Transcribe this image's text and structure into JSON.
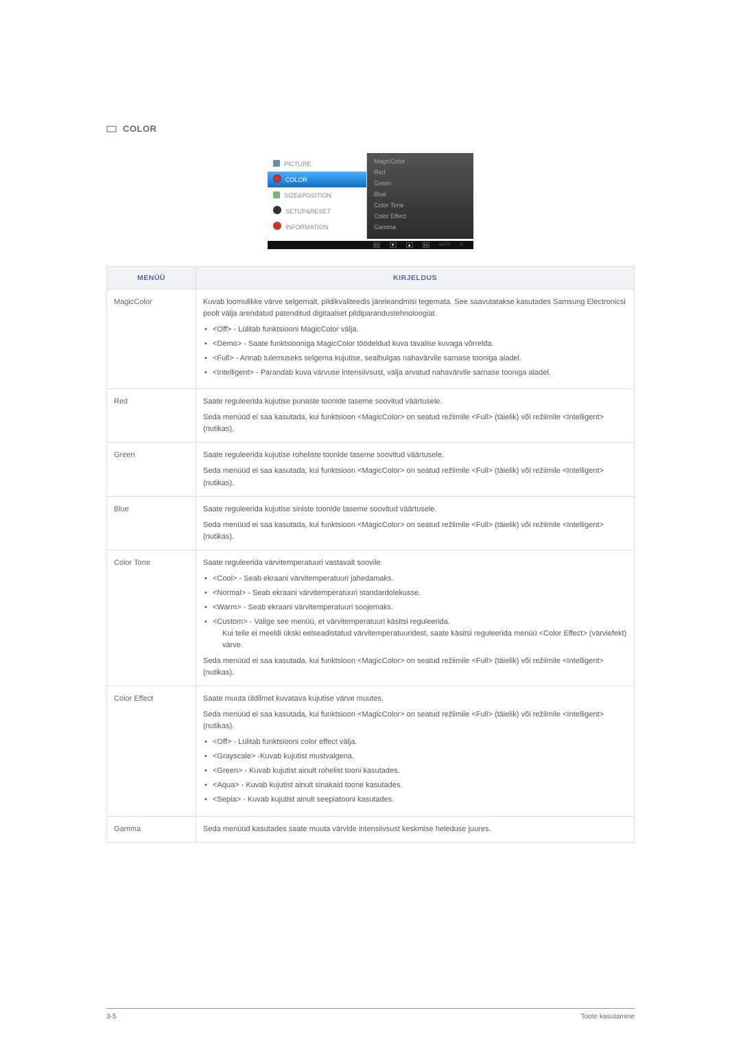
{
  "section": {
    "title": "COLOR"
  },
  "osd": {
    "left": [
      {
        "icon": "picture",
        "label": "PICTURE"
      },
      {
        "icon": "color",
        "label": "COLOR",
        "selected": true
      },
      {
        "icon": "size",
        "label": "SIZE&POSITION"
      },
      {
        "icon": "setup",
        "label": "SETUP&RESET"
      },
      {
        "icon": "info",
        "label": "INFORMATION"
      }
    ],
    "right": [
      "MagicColor",
      "Red",
      "Green",
      "Blue",
      "Color Tone",
      "Color Effect",
      "Gamma"
    ],
    "bottom_auto": "AUTO"
  },
  "table": {
    "head": {
      "menu": "MENÜÜ",
      "desc": "KIRJELDUS"
    },
    "rows": [
      {
        "label": "MagicColor",
        "intro": "Kuvab loomulikke värve selgemalt, pildikvaliteedis järeleandmisi tegemata. See saavutatakse kasutades Samsung Electronicsi poolt välja arendatud patenditud digitaalset pildiparandustehnoloogiat.",
        "bullets": [
          "<Off> - Lülitab funktsiooni MagicColor välja.",
          "<Demo> - Saate funktsiooniga MagicColor töödeldud kuva tavalise kuvaga võrrelda.",
          "<Full> - Annab tulemuseks selgema kujutise, sealhulgas nahavärvile sarnase tooniga aladel.",
          "<Intelligent> - Parandab kuva värvuse intensiivsust, välja arvatud nahavärvile sarnase tooniga aladel."
        ]
      },
      {
        "label": "Red",
        "intro": "Saate reguleerida kujutise punaste toonide taseme soovitud väärtusele.",
        "note": "Seda menüüd ei saa kasutada, kui funktsioon <MagicColor> on seatud režiimile <Full> (täielik) või režiimile <Intelligent> (nutikas)."
      },
      {
        "label": "Green",
        "intro": "Saate reguleerida kujutise roheliste toonide taseme soovitud väärtusele.",
        "note": "Seda menüüd ei saa kasutada, kui funktsioon <MagicColor> on seatud režiimile <Full> (täielik) või režiimile <Intelligent> (nutikas)."
      },
      {
        "label": "Blue",
        "intro": "Saate reguleerida kujutise siniste toonide taseme soovitud väärtusele.",
        "note": "Seda menüüd ei saa kasutada, kui funktsioon <MagicColor> on seatud režiimile <Full> (täielik) või režiimile <Intelligent> (nutikas)."
      },
      {
        "label": "Color Tone",
        "intro": "Saate reguleerida värvitemperatuuri vastavalt soovile.",
        "bullets": [
          "<Cool> - Seab ekraani värvitemperatuuri jahedamaks.",
          "<Normal> - Seab ekraani värvitemperatuuri standardolekusse.",
          "<Warm> - Seab ekraani värvitemperatuuri soojemaks.",
          "<Custom> - Valige see menüü, et värvitemperatuuri käsitsi reguleerida."
        ],
        "sub_after_custom": "Kui teile ei meeldi ükski eelseadistatud värvitemperatuuridest, saate käsitsi reguleerida menüü <Color Effect> (värviefekt) värve.",
        "note": "Seda menüüd ei saa kasutada, kui funktsioon <MagicColor> on seatud režiimile <Full> (täielik) või režiimile <Intelligent> (nutikas)."
      },
      {
        "label": "Color Effect",
        "intro": "Saate muuta üldilmet kuvatava kujutise värve muutes.",
        "note_first": "Seda menüüd ei saa kasutada, kui funktsioon <MagicColor> on seatud režiimile <Full> (täielik) või režiimile <Intelligent> (nutikas).",
        "bullets": [
          "<Off> - Lülitab funktsiooni color effect välja.",
          "<Grayscale> -Kuvab kujutist mustvalgena.",
          "<Green> - Kuvab kujutist ainult rohelist tooni kasutades.",
          "<Aqua> - Kuvab kujutist ainult sinakaid toone kasutades.",
          "<Sepia> - Kuvab kujutist ainult seepiatooni kasutades."
        ]
      },
      {
        "label": "Gamma",
        "intro": "Seda menüüd kasutades saate muuta värvide intensiivsust keskmise heleduse juures."
      }
    ]
  },
  "footer": {
    "left": "3-5",
    "right": "Toote kasutamine"
  }
}
